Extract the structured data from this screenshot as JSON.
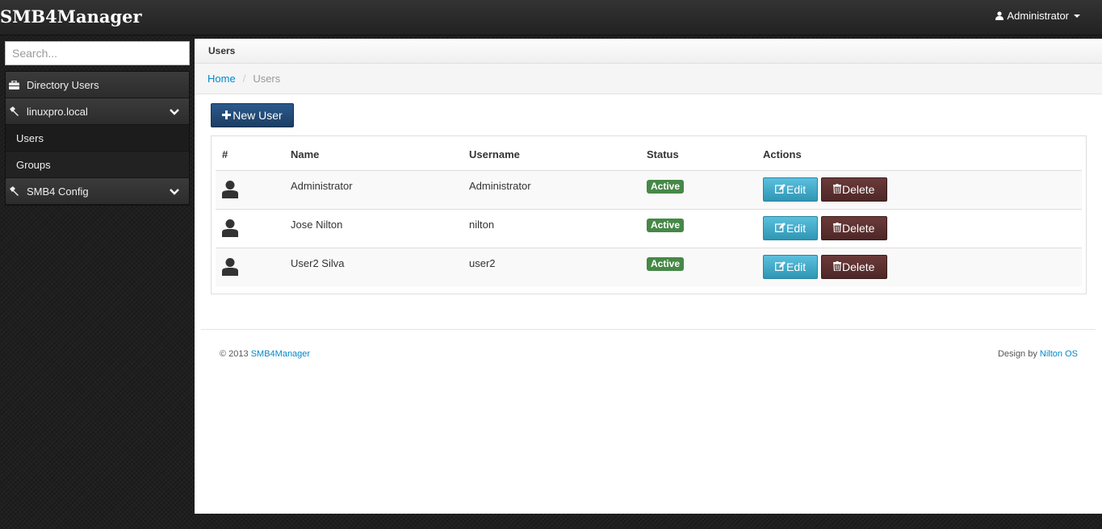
{
  "navbar": {
    "brand": "SMB4Manager",
    "user_label": "Administrator",
    "user_icon": "user-icon"
  },
  "sidebar": {
    "search_placeholder": "Search...",
    "items": [
      {
        "label": "Directory Users",
        "icon": "briefcase-icon"
      },
      {
        "label": "linuxpro.local",
        "icon": "hammer-icon",
        "expanded": true
      },
      {
        "label": "Users"
      },
      {
        "label": "Groups"
      },
      {
        "label": "SMB4 Config",
        "icon": "hammer-icon"
      }
    ]
  },
  "content": {
    "page_title": "Users",
    "breadcrumb": {
      "home": "Home",
      "current": "Users"
    },
    "new_button": "New User",
    "table": {
      "headers": [
        "#",
        "Name",
        "Username",
        "Status",
        "Actions"
      ],
      "rows": [
        {
          "name": "Administrator",
          "username": "Administrator",
          "status": "Active"
        },
        {
          "name": "Jose Nilton",
          "username": "nilton",
          "status": "Active"
        },
        {
          "name": "User2 Silva",
          "username": "user2",
          "status": "Active"
        }
      ],
      "edit_label": "Edit",
      "delete_label": "Delete"
    }
  },
  "footer": {
    "copyright": "© 2013",
    "app_link": "SMB4Manager",
    "design_by": "Design by",
    "designer_link": "Nilton OS"
  },
  "colors": {
    "status_active": "#468847",
    "link": "#0088cc",
    "edit_button": "#49afcd",
    "delete_button": "#5a2f2f",
    "new_button": "#1f426b"
  }
}
